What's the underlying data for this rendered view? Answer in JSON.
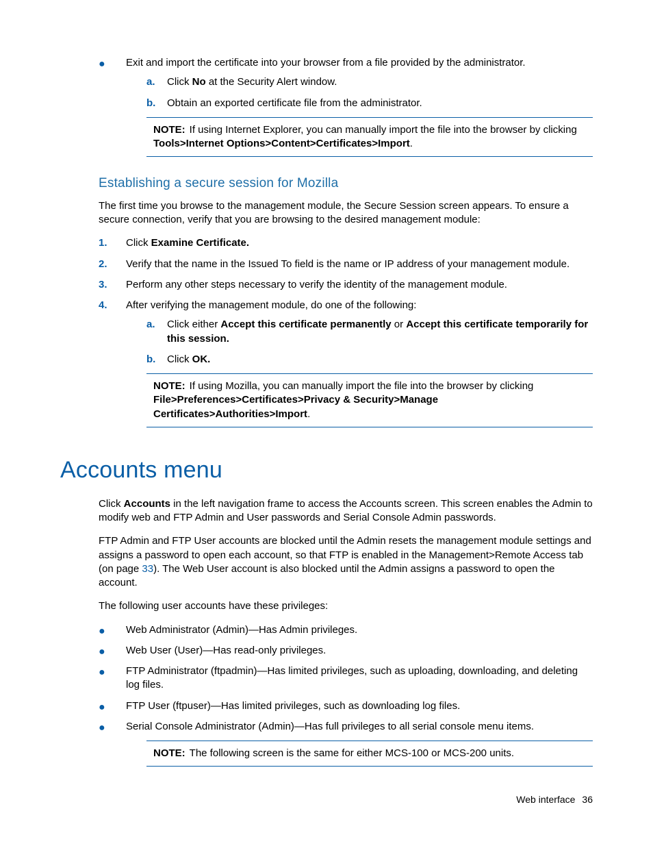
{
  "intro_bullet": {
    "text": "Exit and import the certificate into your browser from a file provided by the administrator.",
    "sub_a_pre": "Click ",
    "sub_a_bold": "No",
    "sub_a_post": " at the Security Alert window.",
    "sub_b": "Obtain an exported certificate file from the administrator."
  },
  "note1": {
    "label": "NOTE:",
    "text_pre": "If using Internet Explorer, you can manually import the file into the browser by clicking ",
    "path": "Tools>Internet Options>Content>Certificates>Import",
    "text_post": "."
  },
  "mozilla": {
    "heading": "Establishing a secure session for Mozilla",
    "p1": "The first time you browse to the management module, the Secure Session screen appears. To ensure a secure connection, verify that you are browsing to the desired management module:",
    "step1_pre": "Click ",
    "step1_bold": "Examine Certificate.",
    "step2": "Verify that the name in the Issued To field is the name or IP address of your management module.",
    "step3": "Perform any other steps necessary to verify the identity of the management module.",
    "step4": "After verifying the management module, do one of the following:",
    "step4a_pre": "Click either ",
    "step4a_b1": "Accept this certificate permanently",
    "step4a_mid": " or ",
    "step4a_b2": "Accept this certificate temporarily for this session.",
    "step4b_pre": "Click ",
    "step4b_bold": "OK."
  },
  "note2": {
    "label": "NOTE:",
    "text_pre": "If using Mozilla, you can manually import the file into the browser by clicking ",
    "path": "File>Preferences>Certificates>Privacy & Security>Manage Certificates>Authorities>Import",
    "text_post": "."
  },
  "accounts": {
    "heading": "Accounts menu",
    "p1_pre": "Click ",
    "p1_bold": "Accounts",
    "p1_post": " in the left navigation frame to access the Accounts screen. This screen enables the Admin to modify web and FTP Admin and User passwords and Serial Console Admin passwords.",
    "p2_pre": "FTP Admin and FTP User accounts are blocked until the Admin resets the management module settings and assigns a password to open each account, so that FTP is enabled in the Management>Remote Access tab (on page ",
    "p2_link": "33",
    "p2_post": "). The Web User account is also blocked until the Admin assigns a password to open the account.",
    "p3": "The following user accounts have these privileges:",
    "b1": "Web Administrator (Admin)—Has Admin privileges.",
    "b2": "Web User (User)—Has read-only privileges.",
    "b3": "FTP Administrator (ftpadmin)—Has limited privileges, such as uploading, downloading, and deleting log files.",
    "b4": "FTP User (ftpuser)—Has limited privileges, such as downloading log files.",
    "b5": "Serial Console Administrator (Admin)—Has full privileges to all serial console menu items."
  },
  "note3": {
    "label": "NOTE:",
    "text": "The following screen is the same for either MCS-100 or MCS-200 units."
  },
  "footer": {
    "section": "Web interface",
    "page": "36"
  }
}
